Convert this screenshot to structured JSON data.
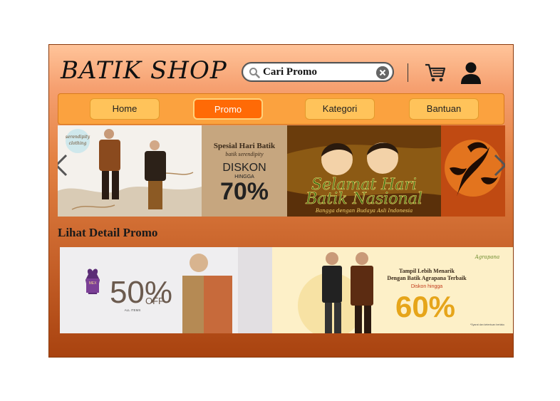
{
  "header": {
    "logo": "BATIK SHOP",
    "search": {
      "value": "Cari Promo"
    }
  },
  "nav": {
    "items": [
      {
        "label": "Home"
      },
      {
        "label": "Promo"
      },
      {
        "label": "Kategori"
      },
      {
        "label": "Bantuan"
      }
    ],
    "active": "Promo"
  },
  "banner": {
    "brand": "serendipity clothing",
    "title": "Spesial Hari Batik",
    "subtitle": "batik serendipity",
    "diskon": "DISKON",
    "hingga": "HINGGA",
    "percent": "70%",
    "slide2_line1": "Selamat Hari",
    "slide2_line2": "Batik Nasional",
    "slide2_caption": "Bangga dengan Budaya Asli Indonesia"
  },
  "promo": {
    "heading": "Lihat Detail Promo",
    "left": {
      "percent": "50%",
      "off": "OFF",
      "all_items": "ALL ITEMS",
      "badge": "MEX"
    },
    "right": {
      "brand": "Agrapana",
      "line1": "Tampil Lebih Menarik",
      "line2": "Dengan Batik Agrapana Terbaik",
      "diskon": "Diskon hingga",
      "percent": "60%",
      "note": "*Syarat dan ketentuan berlaku"
    }
  },
  "colors": {
    "accent": "#ff6a06",
    "nav": "#fba23f",
    "frame_top": "#ffc49a",
    "frame_bottom": "#a8420f"
  }
}
